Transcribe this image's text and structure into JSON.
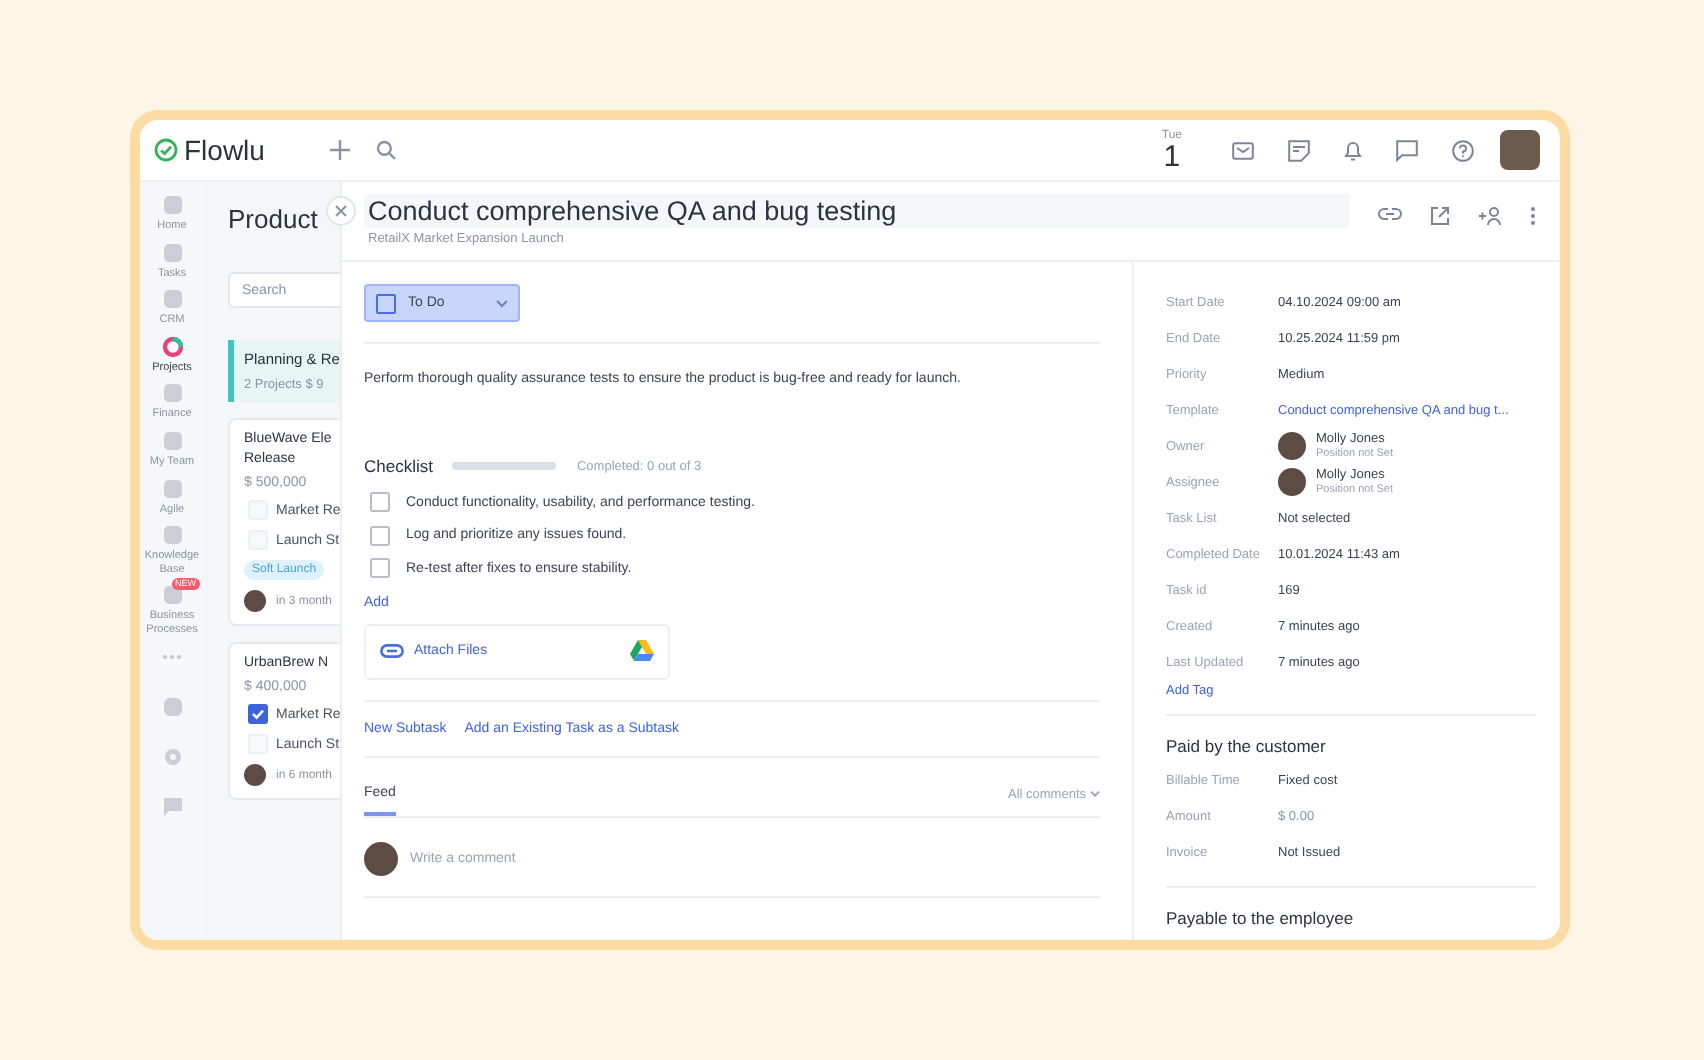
{
  "app": {
    "logo": "Flowlu",
    "weekday": "Tue",
    "day": "1"
  },
  "nav": [
    {
      "label": "Home",
      "selected": false
    },
    {
      "label": "Tasks",
      "selected": false
    },
    {
      "label": "CRM",
      "selected": false
    },
    {
      "label": "Projects",
      "selected": true
    },
    {
      "label": "Finance",
      "selected": false
    },
    {
      "label": "My Team",
      "selected": false
    },
    {
      "label": "Agile",
      "selected": false
    },
    {
      "label": "Knowledge Base",
      "selected": false
    },
    {
      "label": "Business Processes",
      "selected": false,
      "badge": "NEW"
    }
  ],
  "projects": {
    "title": "Product",
    "search_placeholder": "Search",
    "stage": {
      "name": "Planning & Re",
      "summary": "2 Projects  $ 9"
    },
    "cards": [
      {
        "name_lines": [
          "BlueWave Ele",
          "Release"
        ],
        "amount": "$ 500,000",
        "tasks": [
          {
            "label": "Market Re",
            "checked": false
          },
          {
            "label": "Launch St",
            "checked": false
          }
        ],
        "tag": "Soft Launch",
        "due": "in 3 month"
      },
      {
        "name_lines": [
          "UrbanBrew N"
        ],
        "amount": "$ 400,000",
        "tasks": [
          {
            "label": "Market Re",
            "checked": true
          },
          {
            "label": "Launch St",
            "checked": false
          }
        ],
        "due": "in 6 month"
      }
    ]
  },
  "task": {
    "title": "Conduct comprehensive QA and bug testing",
    "project": "RetailX Market Expansion Launch",
    "status": {
      "label": "To Do",
      "checked": false
    },
    "description": "Perform thorough quality assurance tests to ensure the product is bug-free and ready for launch.",
    "checklist": {
      "title": "Checklist",
      "level": 0,
      "progress_text": "Completed: 0 out of 3",
      "add": "Add",
      "items": [
        {
          "label": "Conduct functionality, usability, and performance testing.",
          "checked": false
        },
        {
          "label": "Log and prioritize any issues found.",
          "checked": false
        },
        {
          "label": "Re-test after fixes to ensure stability.",
          "checked": false
        }
      ]
    },
    "attach": "Attach Files",
    "subtask_links": [
      "New Subtask",
      "Add an Existing Task as a Subtask"
    ],
    "feed": {
      "tabs": [
        {
          "label": "Feed",
          "selected": true
        }
      ],
      "filter": "All comments",
      "placeholder": "Write a comment"
    }
  },
  "details": [
    {
      "label": "Start Date",
      "kind": "text",
      "value": "04.10.2024 09:00 am"
    },
    {
      "label": "End Date",
      "kind": "text",
      "value": "10.25.2024 11:59 pm"
    },
    {
      "label": "Priority",
      "kind": "text",
      "value": "Medium"
    },
    {
      "label": "Template",
      "kind": "link",
      "value": "Conduct comprehensive QA and bug t..."
    },
    {
      "label": "Owner",
      "kind": "person",
      "value": "Molly Jones",
      "sub": "Position not Set"
    },
    {
      "label": "Assignee",
      "kind": "person",
      "value": "Molly Jones",
      "sub": "Position not Set"
    },
    {
      "label": "Task List",
      "kind": "text",
      "value": "Not selected"
    },
    {
      "label": "Completed Date",
      "kind": "text",
      "value": "10.01.2024 11:43 am"
    },
    {
      "label": "Task id",
      "kind": "text",
      "value": "169"
    },
    {
      "label": "Created",
      "kind": "text",
      "value": "7 minutes ago"
    },
    {
      "label": "Last Updated",
      "kind": "text",
      "value": "7 minutes ago"
    }
  ],
  "add_tag": "Add Tag",
  "sections": [
    {
      "title": "Paid by the customer",
      "rows": [
        {
          "label": "Billable Time",
          "kind": "text",
          "value": "Fixed cost"
        },
        {
          "label": "Amount",
          "kind": "muted",
          "value": "$ 0.00"
        },
        {
          "label": "Invoice",
          "kind": "text",
          "value": "Not Issued"
        }
      ]
    },
    {
      "title": "Payable to the employee"
    }
  ]
}
